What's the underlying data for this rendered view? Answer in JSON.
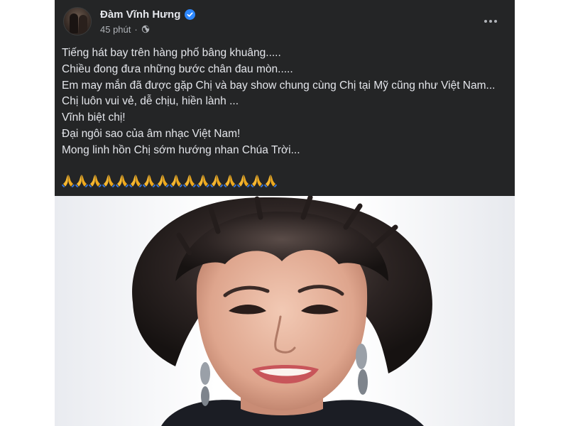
{
  "post": {
    "author": "Đàm Vĩnh Hưng",
    "time": "45 phút",
    "separator": "·",
    "lines": [
      "Tiếng hát bay trên hàng phố bâng khuâng.....",
      "Chiều đong đưa những bước chân đau mòn.....",
      "Em may mắn đã được gặp Chị và bay show chung cùng Chị tại Mỹ cũng như Việt Nam...",
      "Chị luôn vui vẻ, dễ chịu, hiền lành ...",
      "Vĩnh biệt chị!",
      "Đại ngôi sao của âm nhạc Việt Nam!",
      "Mong linh hồn Chị sớm hướng nhan Chúa Trời..."
    ],
    "prayer_emoji_count": 16,
    "icons": {
      "verified": "verified-badge-icon",
      "privacy": "globe-icon",
      "more": "more-options-icon",
      "emoji": "folded-hands-emoji"
    },
    "colors": {
      "background": "#242526",
      "text": "#e4e6eb",
      "secondary_text": "#b0b3b8",
      "verified_blue": "#2d88ff"
    }
  },
  "photo": {
    "subject": "portrait-photo"
  }
}
